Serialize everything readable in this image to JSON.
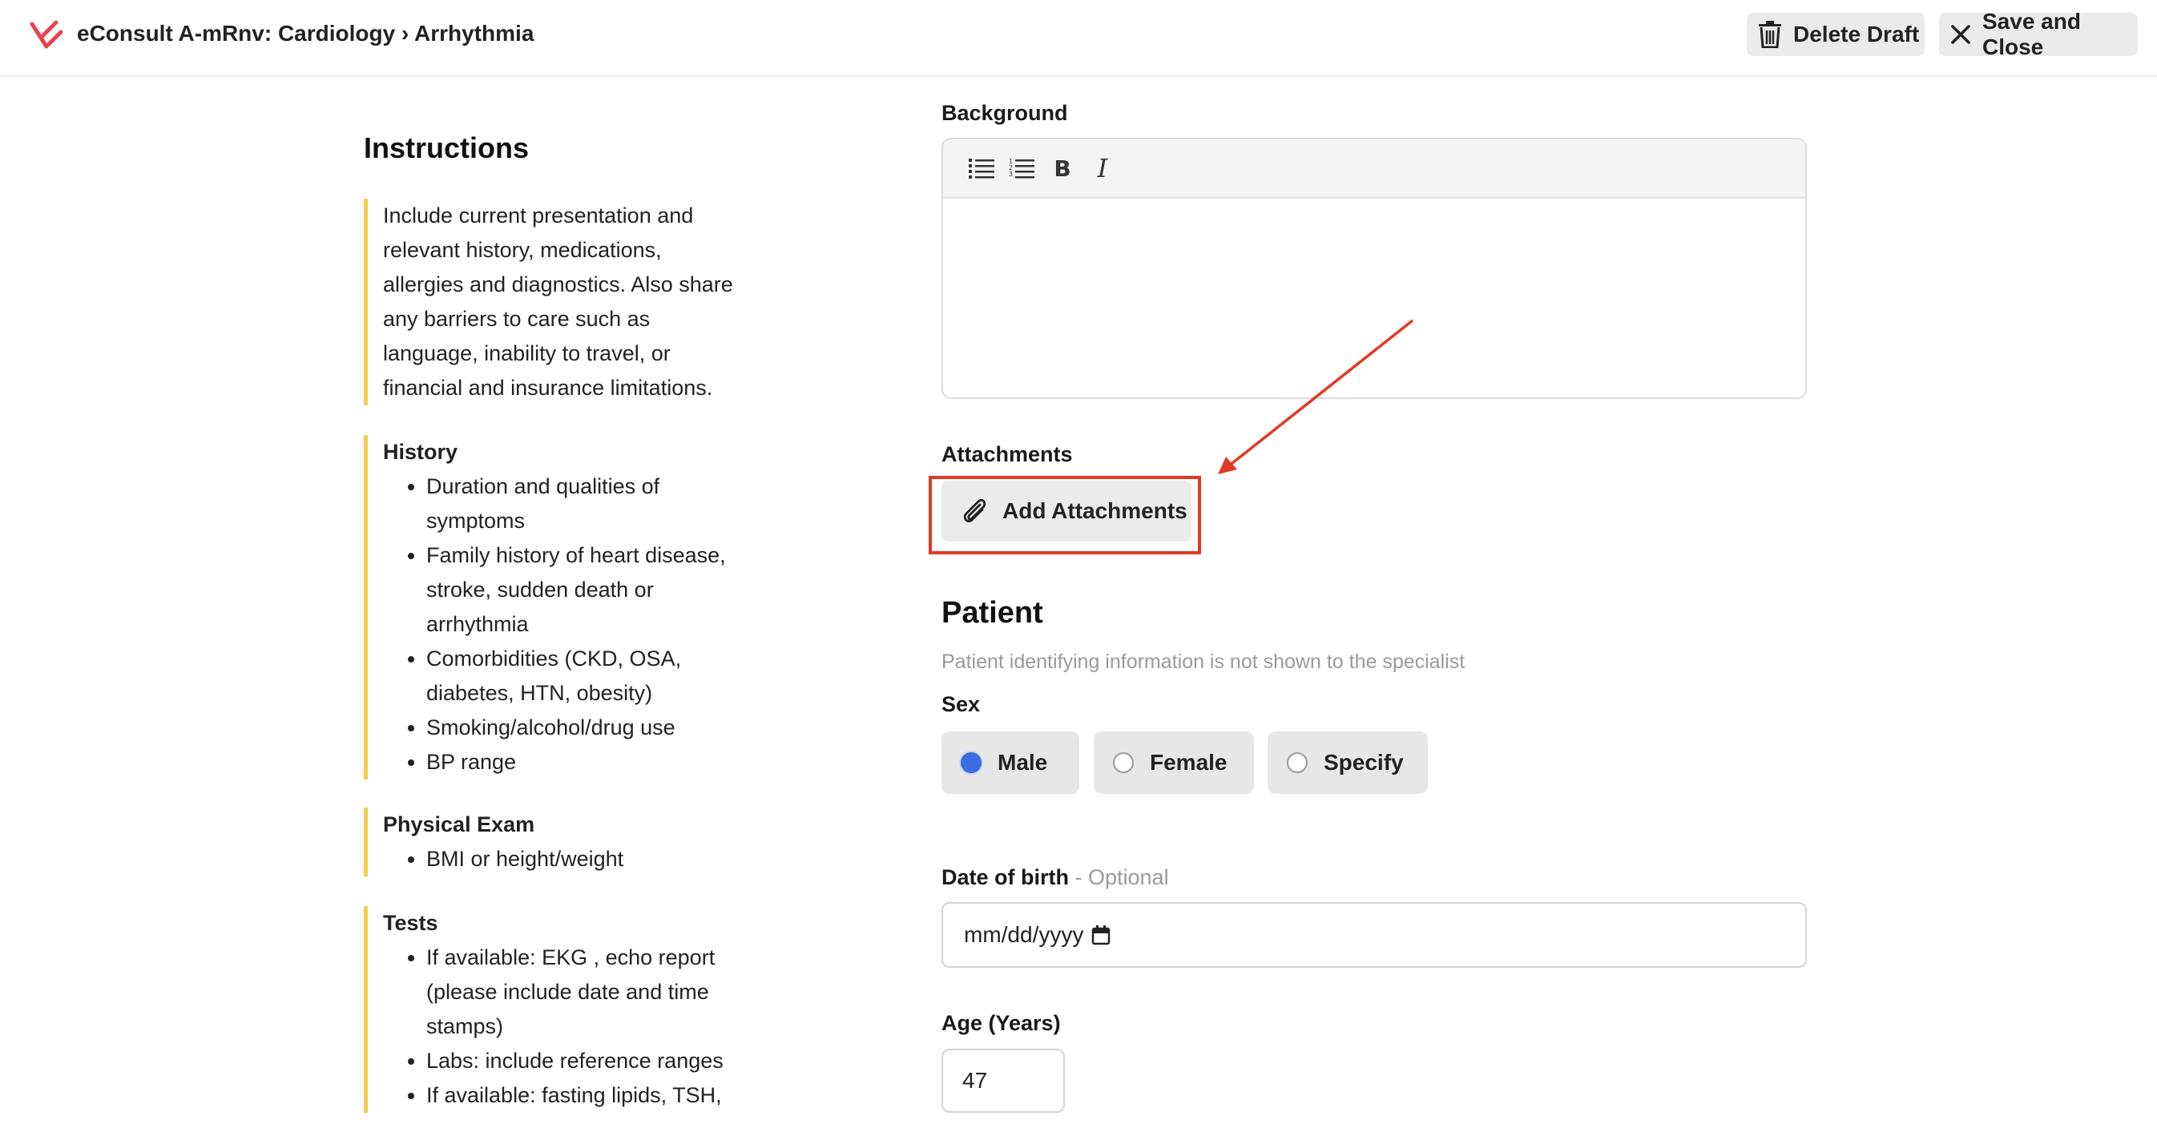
{
  "header": {
    "breadcrumb": "eConsult A-mRnv: Cardiology › Arrhythmia",
    "delete_label": "Delete Draft",
    "save_label": "Save and Close",
    "logo_icon": "app-logo-icon",
    "delete_icon": "trash-icon",
    "close_icon": "close-icon"
  },
  "instructions": {
    "title": "Instructions",
    "intro": "Include current presentation and relevant history, medications, allergies and diagnostics. Also share any barriers to care such as language, inability to travel, or financial and insurance limitations.",
    "sections": [
      {
        "heading": "History",
        "items": [
          "Duration and qualities of symptoms",
          "Family history of heart disease, stroke, sudden death or arrhythmia",
          "Comorbidities (CKD, OSA, diabetes, HTN, obesity)",
          "Smoking/alcohol/drug use",
          "BP range"
        ]
      },
      {
        "heading": "Physical Exam",
        "items": [
          "BMI or height/weight"
        ]
      },
      {
        "heading": "Tests",
        "items": [
          "If available: EKG , echo report (please include date and time stamps)",
          "Labs: include reference ranges",
          "If available: fasting lipids, TSH,"
        ]
      }
    ],
    "accent_color": "#f2cc4d"
  },
  "form": {
    "background_label": "Background",
    "toolbar_icons": [
      "bulleted-list-icon",
      "numbered-list-icon",
      "bold-icon",
      "italic-icon"
    ],
    "bold_glyph": "B",
    "italic_glyph": "I",
    "attachments_label": "Attachments",
    "add_attachments_label": "Add Attachments",
    "patient_title": "Patient",
    "patient_helper": "Patient identifying information is not shown to the specialist",
    "sex_label": "Sex",
    "sex_options": [
      "Male",
      "Female",
      "Specify"
    ],
    "sex_selected": "Male",
    "dob_label": "Date of birth",
    "dob_optional": "- Optional",
    "dob_placeholder": "mm/dd/yyyy",
    "age_label": "Age (Years)",
    "age_value": "47"
  },
  "annotation": {
    "highlight_color": "#e03a24"
  }
}
